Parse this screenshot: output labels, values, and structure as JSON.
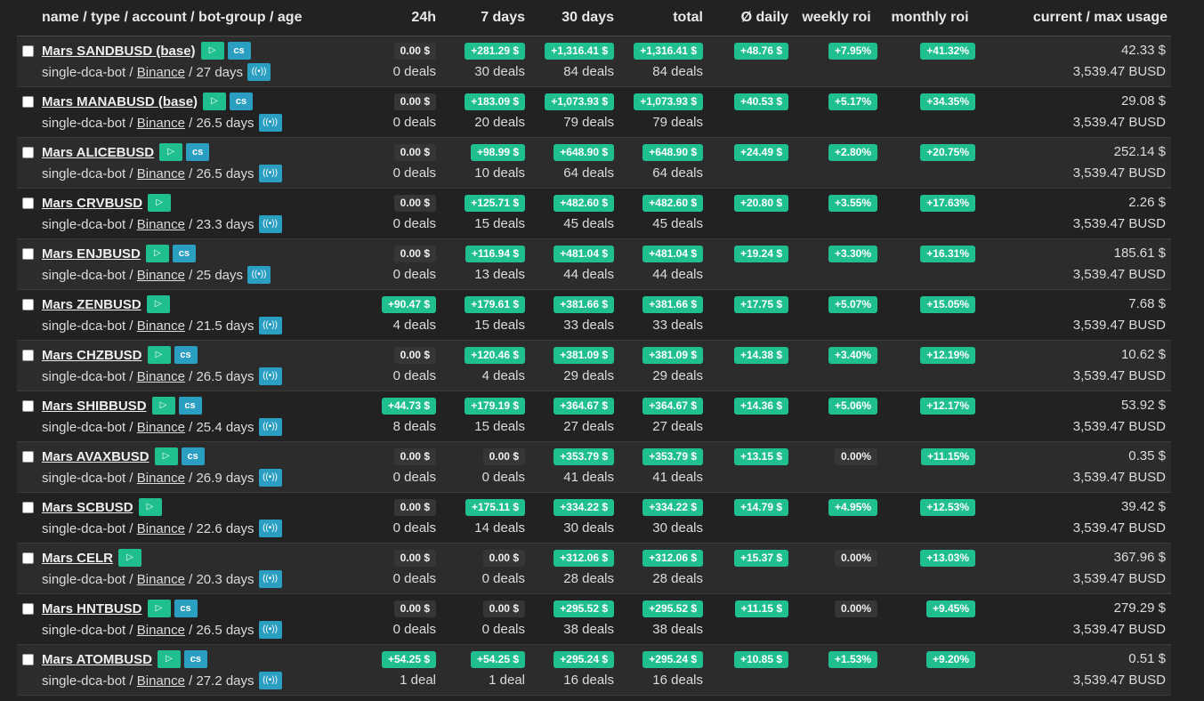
{
  "header": {
    "name": "name / type / account / bot-group / age",
    "h24": "24h",
    "d7": "7 days",
    "d30": "30 days",
    "total": "total",
    "daily": "Ø daily",
    "weekly": "weekly roi",
    "monthly": "monthly roi",
    "usage": "current / max usage"
  },
  "icons": {
    "play": "▷",
    "cs": "cs",
    "signal": "((•))"
  },
  "bots": [
    {
      "name": "Mars SANDBUSD (base)",
      "cs": true,
      "type": "single-dca-bot",
      "account": "Binance",
      "age": "27 days",
      "h24": "0.00 $",
      "h24_deals": "0 deals",
      "d7": "+281.29 $",
      "d7_deals": "30 deals",
      "d30": "+1,316.41 $",
      "d30_deals": "84 deals",
      "total": "+1,316.41 $",
      "total_deals": "84 deals",
      "daily": "+48.76 $",
      "weekly": "+7.95%",
      "monthly": "+41.32%",
      "current": "42.33 $",
      "max": "3,539.47 BUSD"
    },
    {
      "name": "Mars MANABUSD (base)",
      "cs": true,
      "type": "single-dca-bot",
      "account": "Binance",
      "age": "26.5 days",
      "h24": "0.00 $",
      "h24_deals": "0 deals",
      "d7": "+183.09 $",
      "d7_deals": "20 deals",
      "d30": "+1,073.93 $",
      "d30_deals": "79 deals",
      "total": "+1,073.93 $",
      "total_deals": "79 deals",
      "daily": "+40.53 $",
      "weekly": "+5.17%",
      "monthly": "+34.35%",
      "current": "29.08 $",
      "max": "3,539.47 BUSD"
    },
    {
      "name": "Mars ALICEBUSD",
      "cs": true,
      "type": "single-dca-bot",
      "account": "Binance",
      "age": "26.5 days",
      "h24": "0.00 $",
      "h24_deals": "0 deals",
      "d7": "+98.99 $",
      "d7_deals": "10 deals",
      "d30": "+648.90 $",
      "d30_deals": "64 deals",
      "total": "+648.90 $",
      "total_deals": "64 deals",
      "daily": "+24.49 $",
      "weekly": "+2.80%",
      "monthly": "+20.75%",
      "current": "252.14 $",
      "max": "3,539.47 BUSD"
    },
    {
      "name": "Mars CRVBUSD",
      "cs": false,
      "type": "single-dca-bot",
      "account": "Binance",
      "age": "23.3 days",
      "h24": "0.00 $",
      "h24_deals": "0 deals",
      "d7": "+125.71 $",
      "d7_deals": "15 deals",
      "d30": "+482.60 $",
      "d30_deals": "45 deals",
      "total": "+482.60 $",
      "total_deals": "45 deals",
      "daily": "+20.80 $",
      "weekly": "+3.55%",
      "monthly": "+17.63%",
      "current": "2.26 $",
      "max": "3,539.47 BUSD"
    },
    {
      "name": "Mars ENJBUSD",
      "cs": true,
      "type": "single-dca-bot",
      "account": "Binance",
      "age": "25 days",
      "h24": "0.00 $",
      "h24_deals": "0 deals",
      "d7": "+116.94 $",
      "d7_deals": "13 deals",
      "d30": "+481.04 $",
      "d30_deals": "44 deals",
      "total": "+481.04 $",
      "total_deals": "44 deals",
      "daily": "+19.24 $",
      "weekly": "+3.30%",
      "monthly": "+16.31%",
      "current": "185.61 $",
      "max": "3,539.47 BUSD"
    },
    {
      "name": "Mars ZENBUSD",
      "cs": false,
      "type": "single-dca-bot",
      "account": "Binance",
      "age": "21.5 days",
      "h24": "+90.47 $",
      "h24_deals": "4 deals",
      "d7": "+179.61 $",
      "d7_deals": "15 deals",
      "d30": "+381.66 $",
      "d30_deals": "33 deals",
      "total": "+381.66 $",
      "total_deals": "33 deals",
      "daily": "+17.75 $",
      "weekly": "+5.07%",
      "monthly": "+15.05%",
      "current": "7.68 $",
      "max": "3,539.47 BUSD"
    },
    {
      "name": "Mars CHZBUSD",
      "cs": true,
      "type": "single-dca-bot",
      "account": "Binance",
      "age": "26.5 days",
      "h24": "0.00 $",
      "h24_deals": "0 deals",
      "d7": "+120.46 $",
      "d7_deals": "4 deals",
      "d30": "+381.09 $",
      "d30_deals": "29 deals",
      "total": "+381.09 $",
      "total_deals": "29 deals",
      "daily": "+14.38 $",
      "weekly": "+3.40%",
      "monthly": "+12.19%",
      "current": "10.62 $",
      "max": "3,539.47 BUSD"
    },
    {
      "name": "Mars SHIBBUSD",
      "cs": true,
      "type": "single-dca-bot",
      "account": "Binance",
      "age": "25.4 days",
      "h24": "+44.73 $",
      "h24_deals": "8 deals",
      "d7": "+179.19 $",
      "d7_deals": "15 deals",
      "d30": "+364.67 $",
      "d30_deals": "27 deals",
      "total": "+364.67 $",
      "total_deals": "27 deals",
      "daily": "+14.36 $",
      "weekly": "+5.06%",
      "monthly": "+12.17%",
      "current": "53.92 $",
      "max": "3,539.47 BUSD"
    },
    {
      "name": "Mars AVAXBUSD",
      "cs": true,
      "type": "single-dca-bot",
      "account": "Binance",
      "age": "26.9 days",
      "h24": "0.00 $",
      "h24_deals": "0 deals",
      "d7": "0.00 $",
      "d7_deals": "0 deals",
      "d30": "+353.79 $",
      "d30_deals": "41 deals",
      "total": "+353.79 $",
      "total_deals": "41 deals",
      "daily": "+13.15 $",
      "weekly": "0.00%",
      "monthly": "+11.15%",
      "current": "0.35 $",
      "max": "3,539.47 BUSD"
    },
    {
      "name": "Mars SCBUSD",
      "cs": false,
      "type": "single-dca-bot",
      "account": "Binance",
      "age": "22.6 days",
      "h24": "0.00 $",
      "h24_deals": "0 deals",
      "d7": "+175.11 $",
      "d7_deals": "14 deals",
      "d30": "+334.22 $",
      "d30_deals": "30 deals",
      "total": "+334.22 $",
      "total_deals": "30 deals",
      "daily": "+14.79 $",
      "weekly": "+4.95%",
      "monthly": "+12.53%",
      "current": "39.42 $",
      "max": "3,539.47 BUSD"
    },
    {
      "name": "Mars CELR",
      "cs": false,
      "type": "single-dca-bot",
      "account": "Binance",
      "age": "20.3 days",
      "h24": "0.00 $",
      "h24_deals": "0 deals",
      "d7": "0.00 $",
      "d7_deals": "0 deals",
      "d30": "+312.06 $",
      "d30_deals": "28 deals",
      "total": "+312.06 $",
      "total_deals": "28 deals",
      "daily": "+15.37 $",
      "weekly": "0.00%",
      "monthly": "+13.03%",
      "current": "367.96 $",
      "max": "3,539.47 BUSD"
    },
    {
      "name": "Mars HNTBUSD",
      "cs": true,
      "type": "single-dca-bot",
      "account": "Binance",
      "age": "26.5 days",
      "h24": "0.00 $",
      "h24_deals": "0 deals",
      "d7": "0.00 $",
      "d7_deals": "0 deals",
      "d30": "+295.52 $",
      "d30_deals": "38 deals",
      "total": "+295.52 $",
      "total_deals": "38 deals",
      "daily": "+11.15 $",
      "weekly": "0.00%",
      "monthly": "+9.45%",
      "current": "279.29 $",
      "max": "3,539.47 BUSD"
    },
    {
      "name": "Mars ATOMBUSD",
      "cs": true,
      "type": "single-dca-bot",
      "account": "Binance",
      "age": "27.2 days",
      "h24": "+54.25 $",
      "h24_deals": "1 deal",
      "d7": "+54.25 $",
      "d7_deals": "1 deal",
      "d30": "+295.24 $",
      "d30_deals": "16 deals",
      "total": "+295.24 $",
      "total_deals": "16 deals",
      "daily": "+10.85 $",
      "weekly": "+1.53%",
      "monthly": "+9.20%",
      "current": "0.51 $",
      "max": "3,539.47 BUSD"
    }
  ]
}
